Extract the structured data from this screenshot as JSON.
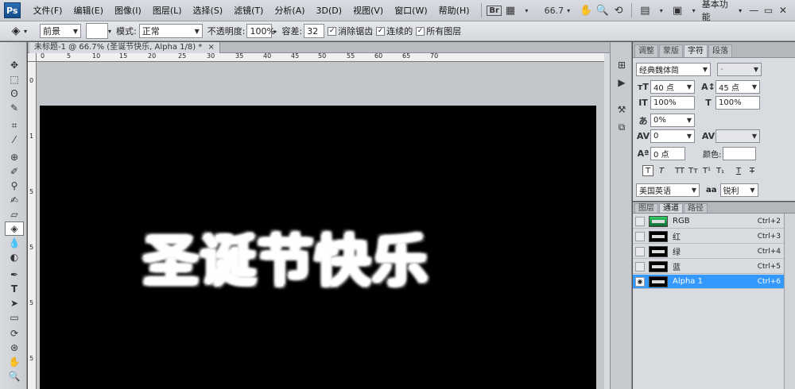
{
  "app": {
    "logo": "Ps"
  },
  "menu": [
    "文件(F)",
    "编辑(E)",
    "图像(I)",
    "图层(L)",
    "选择(S)",
    "滤镜(T)",
    "分析(A)",
    "3D(D)",
    "视图(V)",
    "窗口(W)",
    "帮助(H)"
  ],
  "toolbar_top": {
    "br_label": "Br",
    "zoom": "66.7",
    "workspace": "基本功能"
  },
  "options": {
    "fill_source": "前景",
    "mode_label": "模式:",
    "mode_value": "正常",
    "opacity_label": "不透明度:",
    "opacity_value": "100%",
    "tolerance_label": "容差:",
    "tolerance_value": "32",
    "antialias_label": "消除锯齿",
    "contiguous_label": "连续的",
    "all_layers_label": "所有图层"
  },
  "document": {
    "tab_title": "未标题-1 @ 66.7% (圣诞节快乐, Alpha 1/8) *",
    "close": "×",
    "canvas_text": "圣诞节快乐",
    "ruler_h": [
      "0",
      "5",
      "10",
      "15",
      "20",
      "25",
      "30",
      "35",
      "40",
      "45",
      "50",
      "55",
      "60",
      "65",
      "70"
    ],
    "ruler_v": [
      "0",
      "1",
      "5",
      "5",
      "5",
      "5"
    ]
  },
  "char_panel": {
    "tabs": [
      "调整",
      "蒙版",
      "字符",
      "段落"
    ],
    "active_tab": "字符",
    "font_family": "经典魏体简",
    "font_style": "-",
    "font_size": "40 点",
    "leading": "45 点",
    "vscale": "100%",
    "hscale": "100%",
    "tracking_pct": "0%",
    "kerning": "0",
    "tracking": "",
    "baseline": "0 点",
    "color_label": "颜色:",
    "language": "美国英语",
    "aa_label": "aa",
    "antialias": "锐利"
  },
  "chan_panel": {
    "tabs": [
      "图层",
      "通道",
      "路径"
    ],
    "active_tab": "通道",
    "channels": [
      {
        "name": "RGB",
        "key": "Ctrl+2"
      },
      {
        "name": "红",
        "key": "Ctrl+3"
      },
      {
        "name": "绿",
        "key": "Ctrl+4"
      },
      {
        "name": "蓝",
        "key": "Ctrl+5"
      },
      {
        "name": "Alpha 1",
        "key": "Ctrl+6"
      }
    ]
  },
  "colors": {
    "selected": "#3399ff",
    "canvas": "#000000"
  }
}
